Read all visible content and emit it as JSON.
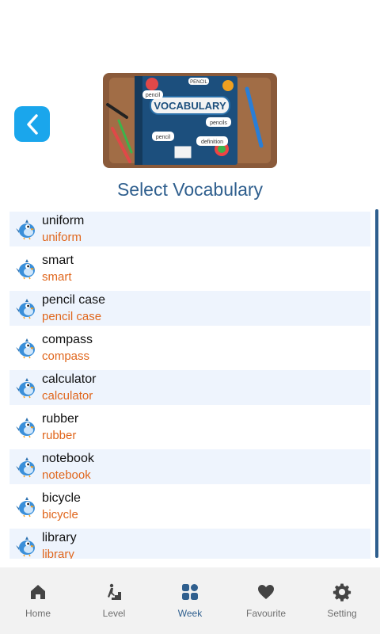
{
  "header": {
    "title": "Select Vocabulary"
  },
  "banner": {
    "book_title": "VOCABULARY",
    "tags": [
      "pencil",
      "pencils",
      "definition",
      "PENCIL"
    ]
  },
  "vocab": [
    {
      "word": "uniform",
      "translation": "uniform"
    },
    {
      "word": "smart",
      "translation": "smart"
    },
    {
      "word": "pencil case",
      "translation": "pencil case"
    },
    {
      "word": "compass",
      "translation": "compass"
    },
    {
      "word": "calculator",
      "translation": "calculator"
    },
    {
      "word": "rubber",
      "translation": "rubber"
    },
    {
      "word": "notebook",
      "translation": "notebook"
    },
    {
      "word": "bicycle",
      "translation": "bicycle"
    },
    {
      "word": "library",
      "translation": "library"
    }
  ],
  "nav": [
    {
      "label": "Home",
      "icon": "home-icon"
    },
    {
      "label": "Level",
      "icon": "level-icon"
    },
    {
      "label": "Week",
      "icon": "grid-icon",
      "active": true
    },
    {
      "label": "Favourite",
      "icon": "heart-icon"
    },
    {
      "label": "Setting",
      "icon": "gear-icon"
    }
  ],
  "colors": {
    "accent": "#2f5f8e",
    "back_button": "#1aa6ec",
    "translation": "#e0661c",
    "row_alt": "#eef4fd"
  }
}
